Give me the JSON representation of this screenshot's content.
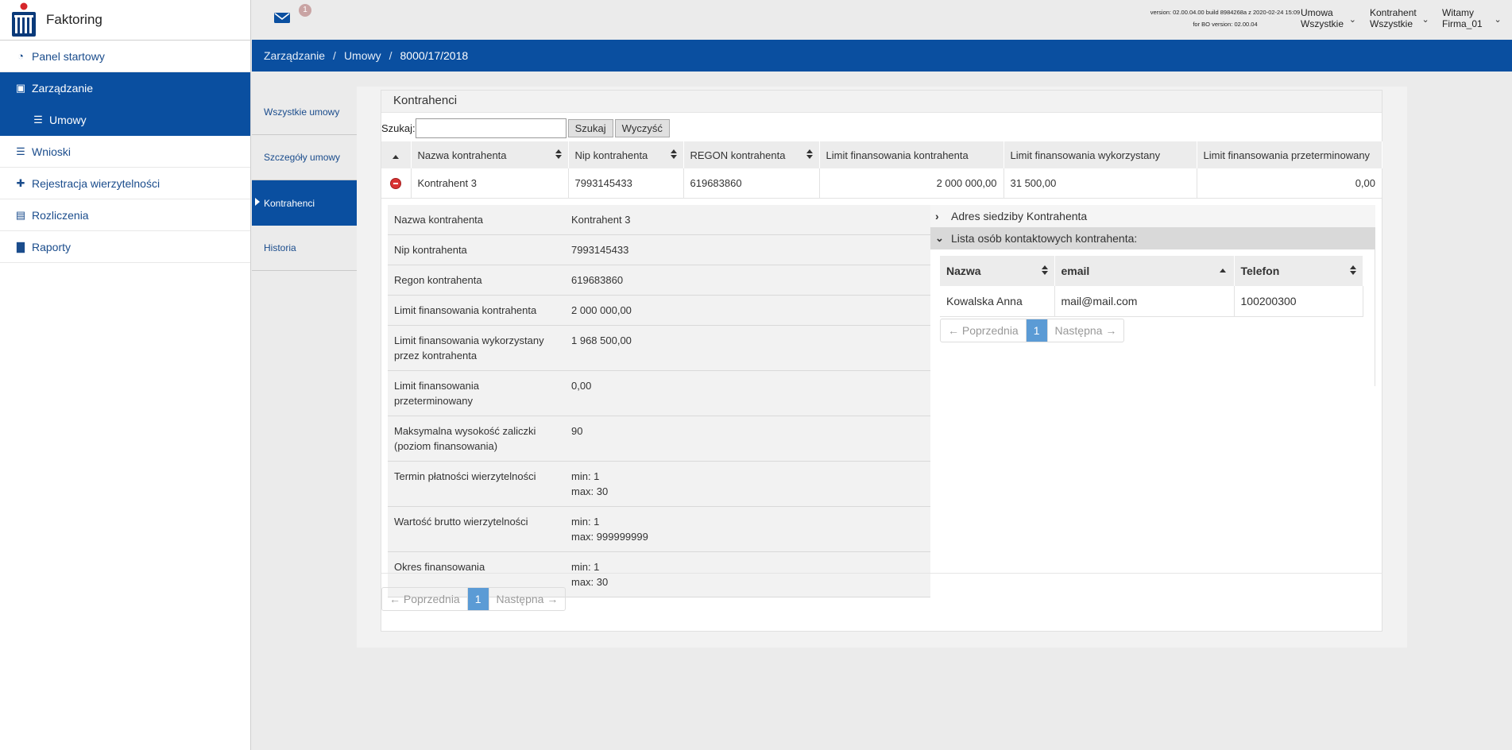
{
  "app": {
    "brand": "Faktoring"
  },
  "sidebar": {
    "items": [
      {
        "label": "Panel startowy",
        "icon": "dashboard-icon",
        "active": false
      },
      {
        "label": "Zarządzanie",
        "icon": "briefcase-icon",
        "active": true
      },
      {
        "label": "Umowy",
        "icon": "document-icon",
        "active": true,
        "sub": true
      },
      {
        "label": "Wnioski",
        "icon": "document-icon",
        "active": false
      },
      {
        "label": "Rejestracja wierzytelności",
        "icon": "plus-icon",
        "active": false
      },
      {
        "label": "Rozliczenia",
        "icon": "money-icon",
        "active": false
      },
      {
        "label": "Raporty",
        "icon": "bar-chart-icon",
        "active": false
      }
    ]
  },
  "topbar": {
    "mail_count": "1",
    "version_line1": "version: 02.00.04.00 build 8984268a z 2020-02-24 15:09",
    "version_line2": "for BO version: 02.00.04",
    "contract": {
      "label": "Umowa",
      "value": "Wszystkie"
    },
    "counterparty": {
      "label": "Kontrahent",
      "value": "Wszystkie"
    },
    "user": {
      "label": "Witamy",
      "value": "Firma_01"
    }
  },
  "breadcrumb": [
    "Zarządzanie",
    "Umowy",
    "8000/17/2018"
  ],
  "subnav": [
    {
      "label": "Wszystkie umowy",
      "active": false
    },
    {
      "label": "Szczegóły umowy",
      "active": false
    },
    {
      "label": "Kontrahenci",
      "active": true
    },
    {
      "label": "Historia",
      "active": false
    }
  ],
  "panel": {
    "title": "Kontrahenci",
    "search_label": "Szukaj:",
    "search_value": "",
    "search_button": "Szukaj",
    "clear_button": "Wyczyść",
    "columns": [
      "Nazwa kontrahenta",
      "Nip kontrahenta",
      "REGON kontrahenta",
      "Limit finansowania kontrahenta",
      "Limit finansowania wykorzystany",
      "Limit finansowania przeterminowany"
    ],
    "rows": [
      [
        "Kontrahent 3",
        "7993145433",
        "619683860",
        "2 000 000,00",
        "31 500,00",
        "0,00"
      ]
    ],
    "details": [
      {
        "label": "Nazwa kontrahenta",
        "value": [
          "Kontrahent 3"
        ]
      },
      {
        "label": "Nip kontrahenta",
        "value": [
          "7993145433"
        ]
      },
      {
        "label": "Regon kontrahenta",
        "value": [
          "619683860"
        ]
      },
      {
        "label": "Limit finansowania kontrahenta",
        "value": [
          "2 000 000,00"
        ]
      },
      {
        "label": "Limit finansowania wykorzystany przez kontrahenta",
        "value": [
          "1 968 500,00"
        ]
      },
      {
        "label": "Limit finansowania przeterminowany",
        "value": [
          "0,00"
        ]
      },
      {
        "label": "Maksymalna wysokość zaliczki (poziom finansowania)",
        "value": [
          "90"
        ]
      },
      {
        "label": "Termin płatności wierzytelności",
        "value": [
          "min: 1",
          "max: 30"
        ]
      },
      {
        "label": "Wartość brutto wierzytelności",
        "value": [
          "min: 1",
          "max: 999999999"
        ]
      },
      {
        "label": "Okres finansowania",
        "value": [
          "min: 1",
          "max: 30"
        ]
      }
    ],
    "address_header": "Adres siedziby Kontrahenta",
    "contacts_header": "Lista osób kontaktowych kontrahenta:",
    "contact_columns": [
      "Nazwa",
      "email",
      "Telefon"
    ],
    "contact_rows": [
      [
        "Kowalska Anna",
        "mail@mail.com",
        "100200300"
      ]
    ],
    "pager": {
      "prev": "← Poprzednia",
      "page": "1",
      "next": "Następna →"
    }
  }
}
